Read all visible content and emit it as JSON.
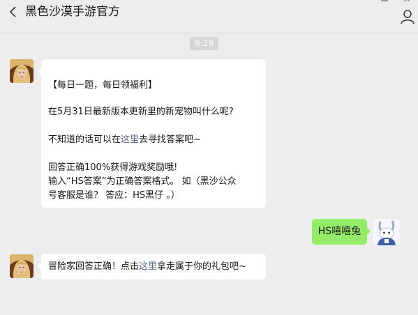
{
  "header": {
    "title": "黑色沙漠手游官方",
    "back_icon": "chevron-left-icon",
    "profile_icon": "person-icon"
  },
  "time_label": "9:29",
  "messages": {
    "first": {
      "sender": "official",
      "line1": "【每日一题，每日领福利】",
      "line2": "在5月31日最新版本更新里的新宠物叫什么呢?",
      "line3_pre": "不知道的话可以在",
      "line3_link": "这里",
      "line3_post": "去寻找答案吧~",
      "line4": "回答正确100%获得游戏奖励哦!",
      "line5": "输入“HS答案”为正确答案格式。 如（黑沙公众",
      "line6": "号客服是谁？ 答应：HS黑仔 。）"
    },
    "reply": {
      "sender": "user",
      "text": "HS嘻嘻兔"
    },
    "second": {
      "sender": "official",
      "pre": "冒险家回答正确！点击",
      "link": "这里",
      "post": "拿走属于你的礼包吧~"
    }
  },
  "colors": {
    "background": "#ededed",
    "incoming_bubble": "#ffffff",
    "outgoing_bubble": "#95ec69",
    "link": "#576b95",
    "time_badge": "#d6d6d6"
  }
}
